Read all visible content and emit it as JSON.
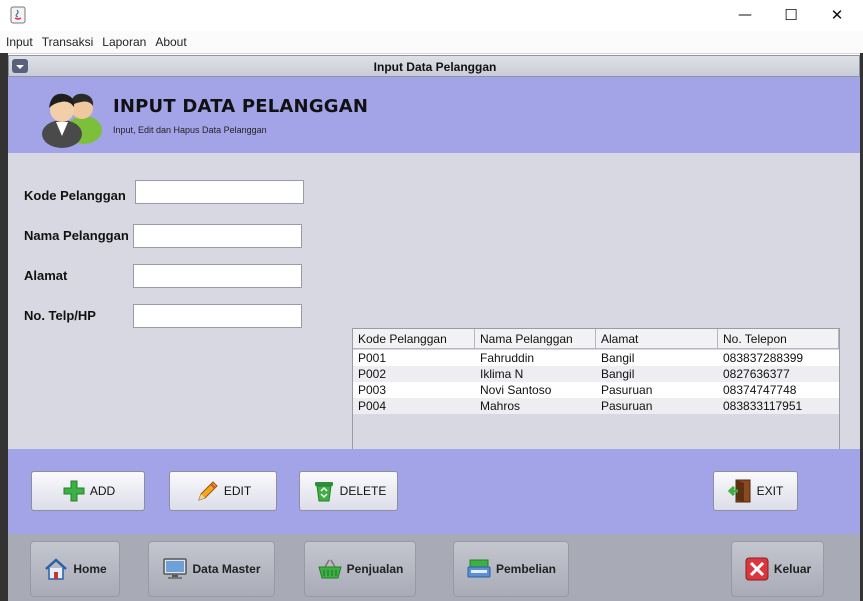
{
  "window": {
    "title": "",
    "controls": {
      "minimize": "—",
      "maximize": "☐",
      "close": "✕"
    }
  },
  "menu": [
    "Input",
    "Transaksi",
    "Laporan",
    "About"
  ],
  "internal_frame": {
    "title": "Input Data Pelanggan"
  },
  "header": {
    "title": "INPUT DATA PELANGGAN",
    "subtitle": "Input, Edit dan Hapus Data Pelanggan"
  },
  "form": {
    "kode_label": "Kode Pelanggan",
    "nama_label": "Nama Pelanggan",
    "alamat_label": "Alamat",
    "telp_label": "No. Telp/HP",
    "kode_value": "",
    "nama_value": "",
    "alamat_value": "",
    "telp_value": ""
  },
  "table": {
    "columns": [
      "Kode Pelanggan",
      "Nama Pelanggan",
      "Alamat",
      "No. Telepon"
    ],
    "rows": [
      [
        "P001",
        "Fahruddin",
        "Bangil",
        "083837288399"
      ],
      [
        "P002",
        "Iklima N",
        "Bangil",
        "0827636377"
      ],
      [
        "P003",
        "Novi Santoso",
        "Pasuruan",
        "08374747748"
      ],
      [
        "P004",
        "Mahros",
        "Pasuruan",
        "083833117951"
      ]
    ]
  },
  "buttons": {
    "add": "ADD",
    "edit": "EDIT",
    "delete": "DELETE",
    "exit": "EXIT"
  },
  "nav": {
    "home": "Home",
    "data_master": "Data Master",
    "penjualan": "Penjualan",
    "pembelian": "Pembelian",
    "keluar": "Keluar"
  },
  "colors": {
    "panel_accent": "#a3a4e8",
    "content_bg": "#d7d8e1",
    "add_green": "#3cb043",
    "exit_red": "#d9363e"
  }
}
